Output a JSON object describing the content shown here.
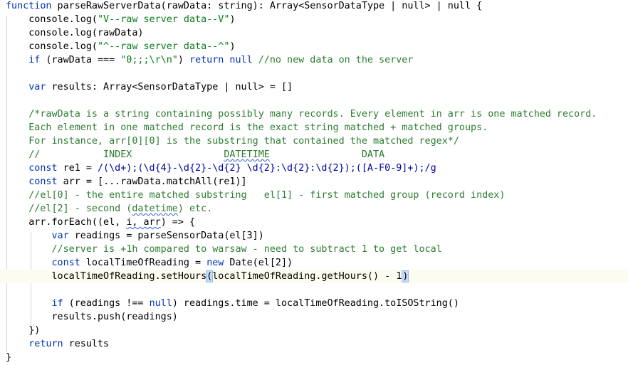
{
  "editor": {
    "lines": [
      [
        {
          "t": "function",
          "c": "kw"
        },
        {
          "t": " parseRawServerData(rawData: string): Array<SensorDataType | null> | null {",
          "c": ""
        }
      ],
      [
        {
          "t": "    console.log(",
          "c": ""
        },
        {
          "t": "\"V--raw server data--V\"",
          "c": "str"
        },
        {
          "t": ")",
          "c": ""
        }
      ],
      [
        {
          "t": "    console.log(rawData)",
          "c": ""
        }
      ],
      [
        {
          "t": "    console.log(",
          "c": ""
        },
        {
          "t": "\"^--raw server data--^\"",
          "c": "str"
        },
        {
          "t": ")",
          "c": ""
        }
      ],
      [
        {
          "t": "    ",
          "c": ""
        },
        {
          "t": "if",
          "c": "kw"
        },
        {
          "t": " (rawData === ",
          "c": ""
        },
        {
          "t": "\"0;;;\\r\\n\"",
          "c": "str"
        },
        {
          "t": ") ",
          "c": ""
        },
        {
          "t": "return null",
          "c": "kw"
        },
        {
          "t": " ",
          "c": ""
        },
        {
          "t": "//no new data on the server",
          "c": "cm"
        }
      ],
      [],
      [
        {
          "t": "    ",
          "c": ""
        },
        {
          "t": "var",
          "c": "kw"
        },
        {
          "t": " results: Array<SensorDataType | null> = []",
          "c": ""
        }
      ],
      [],
      [
        {
          "t": "    /*rawData is a string containing possibly many records. Every element in arr is one matched record.",
          "c": "cm"
        }
      ],
      [
        {
          "t": "    Each element in one matched record is the exact string matched + matched groups.",
          "c": "cm"
        }
      ],
      [
        {
          "t": "    For instance, arr[0][0] is the substring that contained the matched regex*/",
          "c": "cm"
        }
      ],
      [
        {
          "t": "    //           ",
          "c": "cm"
        },
        {
          "t": "INDEX",
          "c": "cm"
        },
        {
          "t": "                ",
          "c": "cm"
        },
        {
          "t": "DATETIME",
          "c": "cm typo"
        },
        {
          "t": "                ",
          "c": "cm"
        },
        {
          "t": "DATA",
          "c": "cm"
        }
      ],
      [
        {
          "t": "    ",
          "c": ""
        },
        {
          "t": "const",
          "c": "kw"
        },
        {
          "t": " re1 = ",
          "c": ""
        },
        {
          "t": "/(\\d+);(\\d{4}-\\d{2}-\\d{2} \\d{2}:\\d{2}:\\d{2});([A-F0-9]+);/g",
          "c": "rx"
        }
      ],
      [
        {
          "t": "    ",
          "c": ""
        },
        {
          "t": "const",
          "c": "kw"
        },
        {
          "t": " arr = [...rawData.matchAll(re1)]",
          "c": ""
        }
      ],
      [
        {
          "t": "    //el[0] - the entire matched substring   el[1] - first matched group (record index)",
          "c": "cm"
        }
      ],
      [
        {
          "t": "    //el[2] - second (",
          "c": "cm"
        },
        {
          "t": "datetime",
          "c": "cm typo"
        },
        {
          "t": ") etc.",
          "c": "cm"
        }
      ],
      [
        {
          "t": "    arr.forEach((el, ",
          "c": ""
        },
        {
          "t": "i, arr",
          "c": "typo"
        },
        {
          "t": ") => {",
          "c": ""
        }
      ],
      [
        {
          "t": "        ",
          "c": ""
        },
        {
          "t": "var",
          "c": "kw"
        },
        {
          "t": " readings = parseSensorData(el[3])",
          "c": ""
        }
      ],
      [
        {
          "t": "        //server is +1h compared to warsaw - need to subtract 1 to get local",
          "c": "cm"
        }
      ],
      [
        {
          "t": "        ",
          "c": ""
        },
        {
          "t": "const",
          "c": "kw"
        },
        {
          "t": " localTimeOfReading = ",
          "c": ""
        },
        {
          "t": "new",
          "c": "kw"
        },
        {
          "t": " Date(el[2])",
          "c": ""
        }
      ],
      [
        {
          "t": "        localTimeOfReading.setHours",
          "c": ""
        },
        {
          "t": "(",
          "c": "paren-hl"
        },
        {
          "t": "localTimeOfReading.getHours() - 1",
          "c": ""
        },
        {
          "t": ")",
          "c": "paren-hl"
        }
      ],
      [],
      [
        {
          "t": "        ",
          "c": ""
        },
        {
          "t": "if",
          "c": "kw"
        },
        {
          "t": " (readings !== ",
          "c": ""
        },
        {
          "t": "null",
          "c": "kw"
        },
        {
          "t": ") readings.time = localTimeOfReading.toISOString()",
          "c": ""
        }
      ],
      [
        {
          "t": "        results.push(readings)",
          "c": ""
        }
      ],
      [
        {
          "t": "    })",
          "c": ""
        }
      ],
      [
        {
          "t": "    ",
          "c": ""
        },
        {
          "t": "return",
          "c": "kw"
        },
        {
          "t": " results",
          "c": ""
        }
      ],
      [
        {
          "t": "}",
          "c": ""
        }
      ]
    ],
    "current_line": 20,
    "lightbulb_line": 20
  }
}
